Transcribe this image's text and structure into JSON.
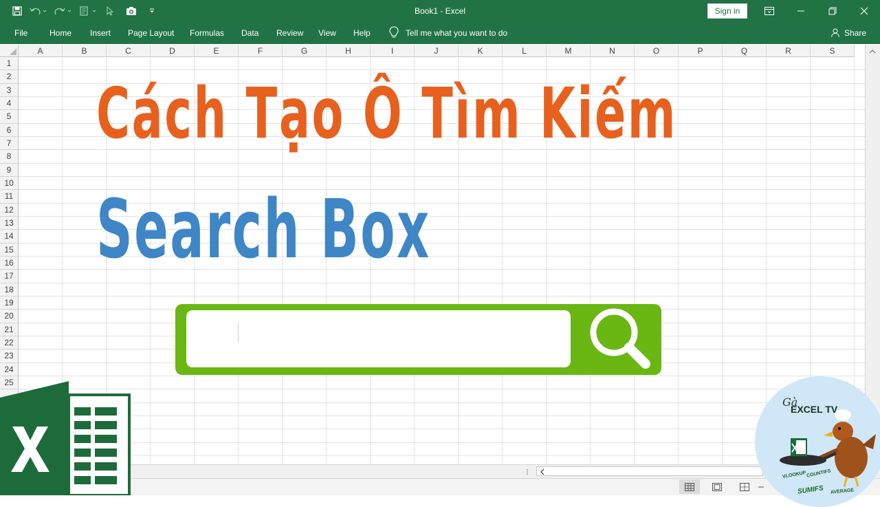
{
  "window": {
    "title": "Book1  -  Excel",
    "sign_in_label": "Sign in"
  },
  "ribbon": {
    "tabs": [
      "File",
      "Home",
      "Insert",
      "Page Layout",
      "Formulas",
      "Data",
      "Review",
      "View",
      "Help"
    ],
    "tell_me": "Tell me what you want to do",
    "share": "Share"
  },
  "sheet": {
    "columns": [
      "A",
      "B",
      "C",
      "D",
      "E",
      "F",
      "G",
      "H",
      "I",
      "J",
      "K",
      "L",
      "M",
      "N",
      "O",
      "P",
      "Q",
      "R",
      "S"
    ],
    "rows": [
      "1",
      "2",
      "3",
      "4",
      "5",
      "6",
      "7",
      "8",
      "9",
      "10",
      "11",
      "12",
      "13",
      "14",
      "15",
      "16",
      "17",
      "18",
      "19",
      "20",
      "21",
      "22",
      "23",
      "24",
      "25"
    ]
  },
  "thumbnail": {
    "title_line1": "Cách Tạo Ô Tìm Kiếm",
    "title_line2": "Search Box",
    "title_line1_color": "#e8601d",
    "title_line2_color": "#3e86c6",
    "search_box_color": "#6ab613",
    "search_icon": "magnifier-icon"
  },
  "badge": {
    "line1": "Gà",
    "line2": "EXCEL TV",
    "words": [
      "COUNTIFS",
      "SUMIFS",
      "VLOOKUP",
      "AVERAGE"
    ]
  },
  "colors": {
    "excel_green": "#217346",
    "logo_green": "#1d6b3a"
  }
}
